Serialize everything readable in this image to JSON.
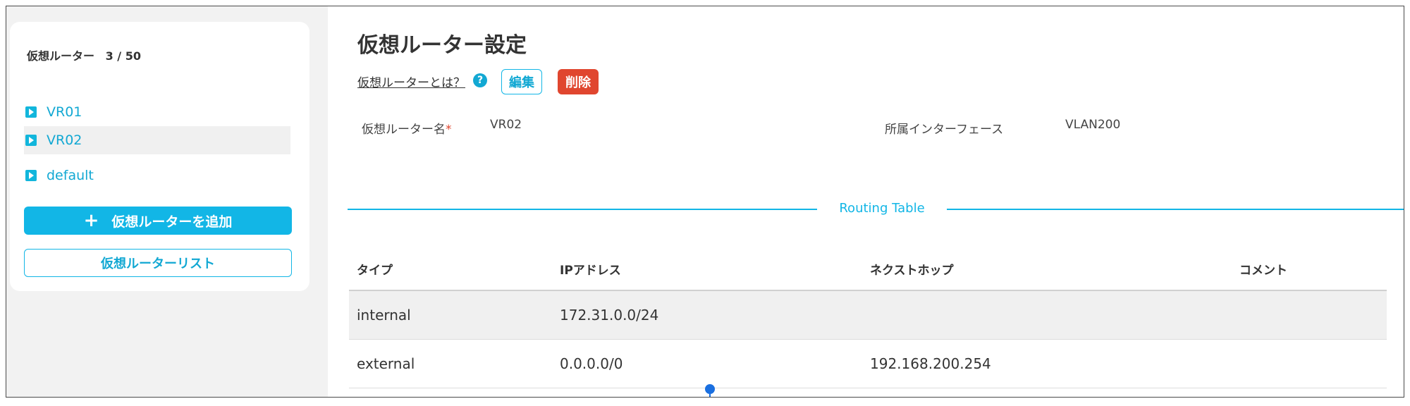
{
  "sidebar": {
    "header_title": "仮想ルーター",
    "header_count": "3 / 50",
    "items": [
      {
        "label": "VR01"
      },
      {
        "label": "VR02"
      },
      {
        "label": "default"
      }
    ],
    "selected_item": "VR02",
    "add_button_icon": "plus-icon",
    "add_button_label": "仮想ルーターを追加",
    "list_button_label": "仮想ルーターリスト"
  },
  "main": {
    "title": "仮想ルーター設定",
    "what_link": "仮想ルーターとは？",
    "help_icon": "question-circle-icon",
    "help_glyph": "?",
    "edit_label": "編集",
    "delete_label": "削除",
    "fields": {
      "router_name_label": "仮想ルーター名",
      "router_name_required": "*",
      "router_name_value": "VR02",
      "interface_label": "所属インターフェース",
      "interface_value": "VLAN200"
    },
    "section_title": "Routing Table",
    "table": {
      "headers": [
        "タイプ",
        "IPアドレス",
        "ネクストホップ",
        "コメント"
      ],
      "rows": [
        [
          "internal",
          "172.31.0.0/24",
          "",
          ""
        ],
        [
          "external",
          "0.0.0.0/0",
          "192.168.200.254",
          ""
        ]
      ]
    }
  },
  "colors": {
    "accent": "#12b6e6",
    "link_text": "#12a8d3",
    "delete": "#e0462f",
    "cursor": "#1a6fe0",
    "shaded_row": "#f0f0f0"
  }
}
